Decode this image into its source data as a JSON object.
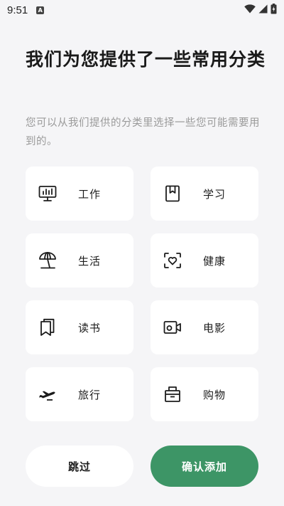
{
  "status_bar": {
    "time": "9:51",
    "notification_letter": "A"
  },
  "header": {
    "title": "我们为您提供了一些常用分类",
    "subtitle": "您可以从我们提供的分类里选择一些您可能需要用到的。"
  },
  "categories": [
    {
      "label": "工作",
      "icon": "monitor-chart-icon"
    },
    {
      "label": "学习",
      "icon": "bookmark-book-icon"
    },
    {
      "label": "生活",
      "icon": "beach-umbrella-icon"
    },
    {
      "label": "健康",
      "icon": "heart-scan-icon"
    },
    {
      "label": "读书",
      "icon": "books-icon"
    },
    {
      "label": "电影",
      "icon": "video-camera-icon"
    },
    {
      "label": "旅行",
      "icon": "airplane-icon"
    },
    {
      "label": "购物",
      "icon": "shopping-bag-icon"
    }
  ],
  "actions": {
    "skip_label": "跳过",
    "confirm_label": "确认添加"
  },
  "colors": {
    "accent": "#3d9566",
    "background": "#f5f5f7",
    "card": "#ffffff"
  }
}
